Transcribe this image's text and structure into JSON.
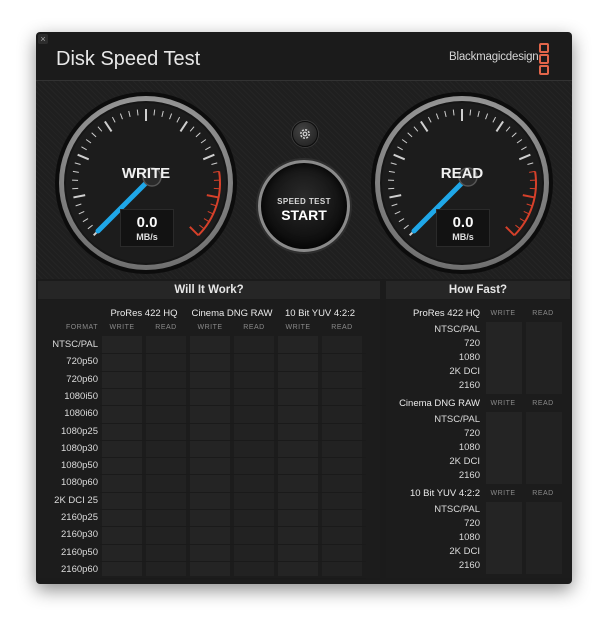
{
  "window": {
    "title": "Disk Speed Test",
    "brand": "Blackmagicdesign",
    "close_glyph": "×"
  },
  "icons": {
    "close": "close-icon",
    "settings": "gear-icon",
    "brand": "blackmagic-logo-icon"
  },
  "colors": {
    "needle": "#1fa7e8",
    "redzone": "#d6402a",
    "brand_accent": "#e2664a",
    "window_bg": "#1b1b1b"
  },
  "gauges": {
    "write": {
      "label": "WRITE",
      "value": "0.0",
      "unit": "MB/s"
    },
    "read": {
      "label": "READ",
      "value": "0.0",
      "unit": "MB/s"
    }
  },
  "start_button": {
    "line1": "SPEED TEST",
    "line2": "START"
  },
  "will_it_work": {
    "title": "Will It Work?",
    "format_label": "FORMAT",
    "codecs": [
      "ProRes 422 HQ",
      "Cinema DNG RAW",
      "10 Bit YUV 4:2:2"
    ],
    "sub_labels": [
      "WRITE",
      "READ"
    ],
    "formats": [
      "NTSC/PAL",
      "720p50",
      "720p60",
      "1080i50",
      "1080i60",
      "1080p25",
      "1080p30",
      "1080p50",
      "1080p60",
      "2K DCI 25",
      "2160p25",
      "2160p30",
      "2160p50",
      "2160p60"
    ]
  },
  "how_fast": {
    "title": "How Fast?",
    "sub_labels": [
      "WRITE",
      "READ"
    ],
    "groups": [
      {
        "codec": "ProRes 422 HQ",
        "rows": [
          "NTSC/PAL",
          "720",
          "1080",
          "2K DCI",
          "2160"
        ]
      },
      {
        "codec": "Cinema DNG RAW",
        "rows": [
          "NTSC/PAL",
          "720",
          "1080",
          "2K DCI",
          "2160"
        ]
      },
      {
        "codec": "10 Bit YUV 4:2:2",
        "rows": [
          "NTSC/PAL",
          "720",
          "1080",
          "2K DCI",
          "2160"
        ]
      }
    ]
  }
}
